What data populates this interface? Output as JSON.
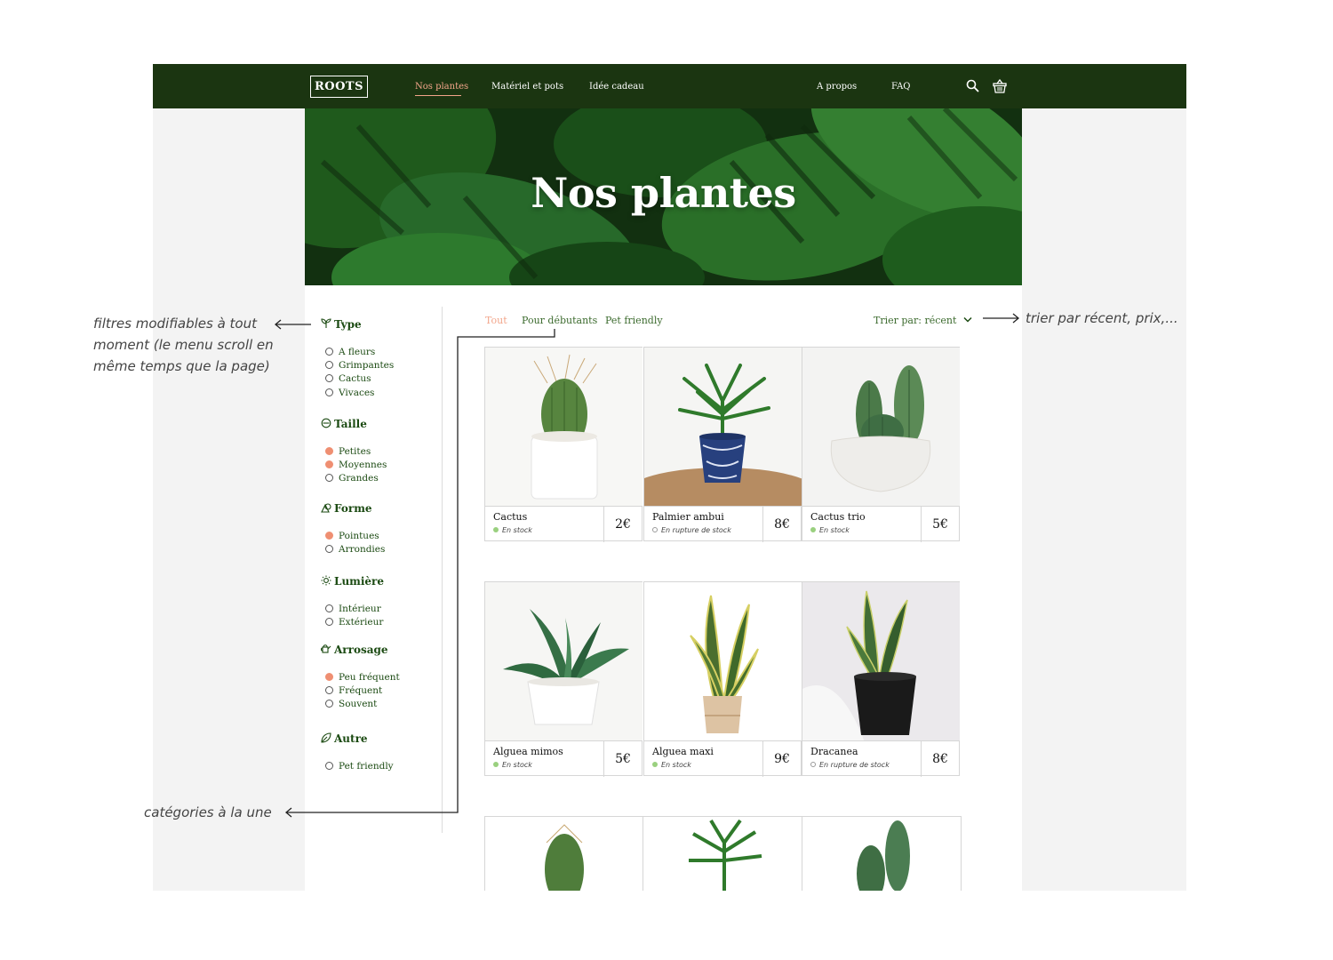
{
  "nav": {
    "logo": "ROOTS",
    "links": [
      "Nos plantes",
      "Matériel et pots",
      "Idée cadeau",
      "A propos",
      "FAQ"
    ],
    "active": "Nos plantes"
  },
  "hero": {
    "title": "Nos plantes"
  },
  "filters": [
    {
      "heading": "Type",
      "icon": "leaf-sprout-icon",
      "options": [
        {
          "label": "A fleurs",
          "checked": false
        },
        {
          "label": "Grimpantes",
          "checked": false
        },
        {
          "label": "Cactus",
          "checked": false
        },
        {
          "label": "Vivaces",
          "checked": false
        }
      ]
    },
    {
      "heading": "Taille",
      "icon": "size-circle-icon",
      "options": [
        {
          "label": "Petites",
          "checked": true
        },
        {
          "label": "Moyennes",
          "checked": true
        },
        {
          "label": "Grandes",
          "checked": false
        }
      ]
    },
    {
      "heading": "Forme",
      "icon": "shapes-icon",
      "options": [
        {
          "label": "Pointues",
          "checked": true
        },
        {
          "label": "Arrondies",
          "checked": false
        }
      ]
    },
    {
      "heading": "Lumière",
      "icon": "sun-icon",
      "options": [
        {
          "label": "Intérieur",
          "checked": false
        },
        {
          "label": "Extérieur",
          "checked": false
        }
      ]
    },
    {
      "heading": "Arrosage",
      "icon": "watering-can-icon",
      "options": [
        {
          "label": "Peu fréquent",
          "checked": true
        },
        {
          "label": "Fréquent",
          "checked": false
        },
        {
          "label": "Souvent",
          "checked": false
        }
      ]
    },
    {
      "heading": "Autre",
      "icon": "leaf-icon",
      "options": [
        {
          "label": "Pet friendly",
          "checked": false
        }
      ]
    }
  ],
  "categories": {
    "tabs": [
      "Tout",
      "Pour débutants",
      "Pet friendly"
    ],
    "active": "Tout"
  },
  "sort": {
    "label": "Trier par: récent"
  },
  "products": [
    {
      "name": "Cactus",
      "stock": "En stock",
      "in_stock": true,
      "price": "2€"
    },
    {
      "name": "Palmier ambui",
      "stock": "En rupture de stock",
      "in_stock": false,
      "price": "8€"
    },
    {
      "name": "Cactus trio",
      "stock": "En stock",
      "in_stock": true,
      "price": "5€"
    },
    {
      "name": "Alguea mimos",
      "stock": "En stock",
      "in_stock": true,
      "price": "5€"
    },
    {
      "name": "Alguea maxi",
      "stock": "En stock",
      "in_stock": true,
      "price": "9€"
    },
    {
      "name": "Dracanea",
      "stock": "En rupture de stock",
      "in_stock": false,
      "price": "8€"
    }
  ],
  "annotations": {
    "filters_note": [
      "filtres modifiables à tout",
      "moment (le menu scroll en",
      "même temps que la page)"
    ],
    "sort_note": "trier par récent, prix,...",
    "categories_note": "catégories à la une"
  },
  "colors": {
    "nav_bg": "#1b3511",
    "accent": "#f2a58a",
    "text_green": "#1b4a12",
    "checked": "#ef8f72"
  }
}
